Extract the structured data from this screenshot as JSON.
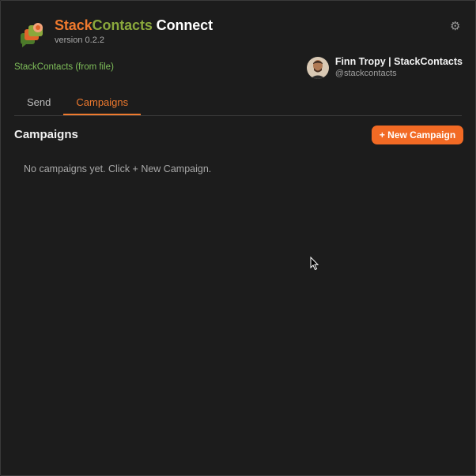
{
  "app": {
    "title_part1": "Stack",
    "title_part2": "Contacts",
    "title_part3": " Connect",
    "version": "version 0.2.2"
  },
  "icons": {
    "logo": "stackcontacts-logo-icon",
    "settings": "gear-icon",
    "cursor": "mouse-pointer-icon"
  },
  "source_label": "StackContacts (from file)",
  "user": {
    "name": "Finn Tropy | StackContacts",
    "handle": "@stackcontacts"
  },
  "tabs": [
    {
      "label": "Send",
      "active": false
    },
    {
      "label": "Campaigns",
      "active": true
    }
  ],
  "main": {
    "section_title": "Campaigns",
    "new_button_label": "+ New Campaign",
    "empty_message": "No campaigns yet. Click + New Campaign."
  },
  "colors": {
    "accent": "#f07a2e",
    "brand_green": "#8aa83c",
    "source_green": "#7fbf5a",
    "background": "#1c1c1c"
  }
}
